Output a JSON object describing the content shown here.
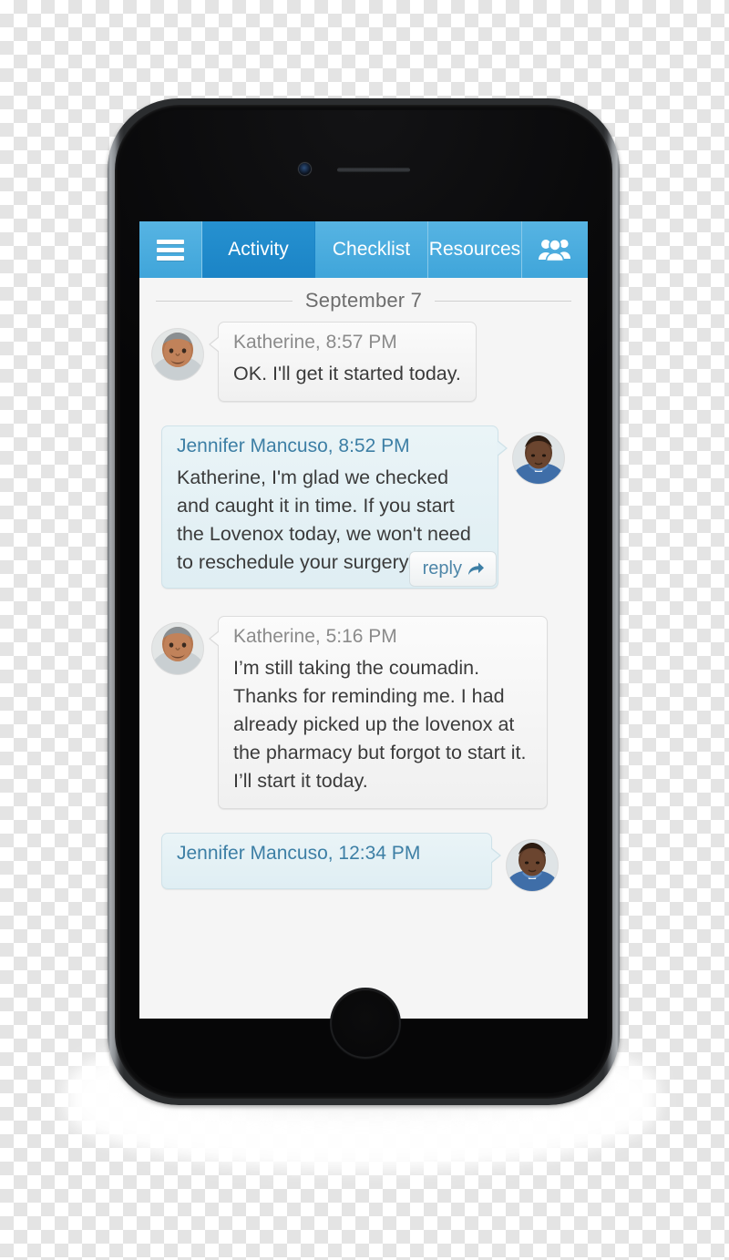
{
  "app": {
    "nav": {
      "menu_icon": "hamburger-menu-icon",
      "people_icon": "people-group-icon",
      "tabs": [
        {
          "label": "Activity",
          "active": true
        },
        {
          "label": "Checklist",
          "active": false
        },
        {
          "label": "Resources",
          "active": false
        }
      ]
    },
    "thread": {
      "date_separator": "September 7",
      "messages": [
        {
          "side": "them",
          "style": "grey",
          "author_time": "Katherine, 8:57 PM",
          "body": "OK. I'll get it started today.",
          "avatar": "elderly-woman-avatar",
          "reply_label": null
        },
        {
          "side": "me",
          "style": "blue",
          "author_time": "Jennifer Mancuso, 8:52 PM",
          "body": "Katherine, I'm glad we checked and caught it in time. If you start the Lovenox today, we won't need to reschedule your surgery.",
          "avatar": "nurse-avatar",
          "reply_label": "reply"
        },
        {
          "side": "them",
          "style": "grey",
          "author_time": "Katherine, 5:16 PM",
          "body": "I’m still taking the coumadin. Thanks for reminding me. I had already picked up the lovenox at the pharmacy but forgot to start it. I’ll start it today.",
          "avatar": "elderly-woman-avatar",
          "reply_label": null
        },
        {
          "side": "me",
          "style": "blue",
          "author_time": "Jennifer Mancuso, 12:34 PM",
          "body": "",
          "avatar": "nurse-avatar",
          "reply_label": null
        }
      ]
    }
  },
  "colors": {
    "nav_active": "#1b84c6",
    "nav_inactive": "#4fadde",
    "screen_bg": "#f5f5f5",
    "bubble_grey": "#f3f3f3",
    "bubble_blue": "#e4f0f5",
    "link_blue": "#3d7fa5"
  }
}
